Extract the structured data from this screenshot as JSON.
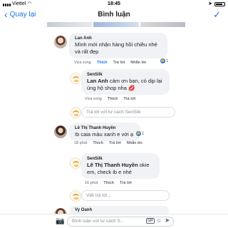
{
  "status_bar": {
    "carrier": "Viettel",
    "time": "18:45"
  },
  "nav": {
    "back_label": "Quay lại",
    "title": "Bình luận",
    "done_icon": "checkmark-icon"
  },
  "comments": [
    {
      "author": "Lan Anh",
      "text": "Mình mới nhận hàng hồi chiều nhé và rất đẹp",
      "time": "Vừa xong",
      "like": "Thích",
      "reply": "Trả lời",
      "message": "Nhắn tin",
      "reaction_count": "1"
    },
    {
      "author": "SenSilk",
      "mention": "Lan Anh",
      "text": "cảm ơn bạn, có dịp lại ủng hộ shop nha",
      "time": "Vừa xong",
      "like": "Thích",
      "reply": "Trả lời",
      "reply_placeholder": "Trả lời với tư cách SenSilk"
    },
    {
      "author": "Lê Thị Thanh Huyền",
      "text": "Ib caia màu xanh e với ạ",
      "time": "18 phút",
      "like": "Thích",
      "reply": "Trả lời",
      "message": "Nhắn tin",
      "reaction_count": "1"
    },
    {
      "author": "SenSilk",
      "mention": "Lê Thị Thanh Huyền",
      "text": "okie em, check ib e nhé",
      "time": "16 phút",
      "like": "Thích",
      "reply": "Trả lời",
      "reply_placeholder": "Viết trả lời..."
    },
    {
      "author": "Vy Oanh",
      "text": "Trả lời với tư cách S..."
    }
  ],
  "composer": {
    "placeholder": "Bình luận với tư cách S...",
    "gif_label": "GIF"
  },
  "colors": {
    "accent": "#1877f2",
    "bubble": "#f0f2f5"
  }
}
